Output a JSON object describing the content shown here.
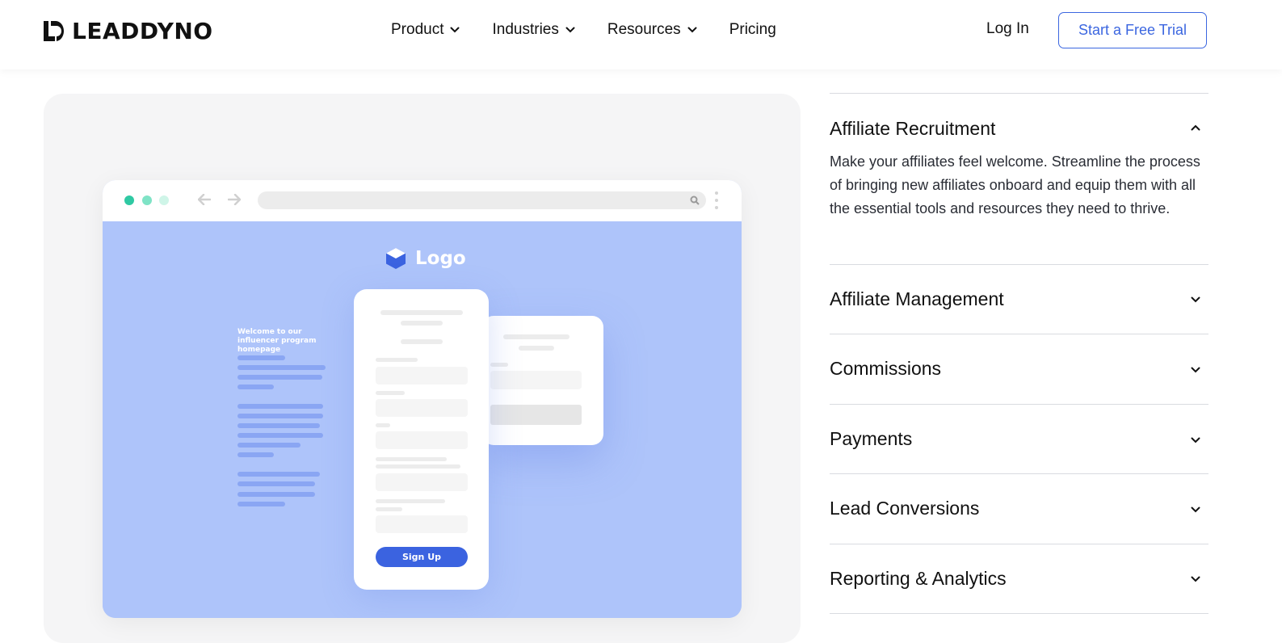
{
  "brand": {
    "name": "LEADDYNO",
    "accent_color": "#3b66e0"
  },
  "nav": {
    "items": [
      {
        "label": "Product",
        "has_dropdown": true
      },
      {
        "label": "Industries",
        "has_dropdown": true
      },
      {
        "label": "Resources",
        "has_dropdown": true
      },
      {
        "label": "Pricing",
        "has_dropdown": false
      }
    ],
    "login": "Log In",
    "cta": "Start a Free Trial"
  },
  "illustration": {
    "logo_text": "Logo",
    "welcome_text": "Welcome to our influencer program homepage",
    "signup_label": "Sign Up",
    "background_color": "#aec4fa",
    "dot_colors": [
      "#2fc9a3",
      "#7fe3c6",
      "#cff5e8"
    ]
  },
  "accordion": {
    "items": [
      {
        "title": "Affiliate Recruitment",
        "expanded": true,
        "body": "Make your affiliates feel welcome. Streamline the process of bringing new affiliates onboard and equip them with all the essential tools and resources they need to thrive."
      },
      {
        "title": "Affiliate Management",
        "expanded": false
      },
      {
        "title": "Commissions",
        "expanded": false
      },
      {
        "title": "Payments",
        "expanded": false
      },
      {
        "title": "Lead Conversions",
        "expanded": false
      },
      {
        "title": "Reporting & Analytics",
        "expanded": false
      }
    ]
  }
}
